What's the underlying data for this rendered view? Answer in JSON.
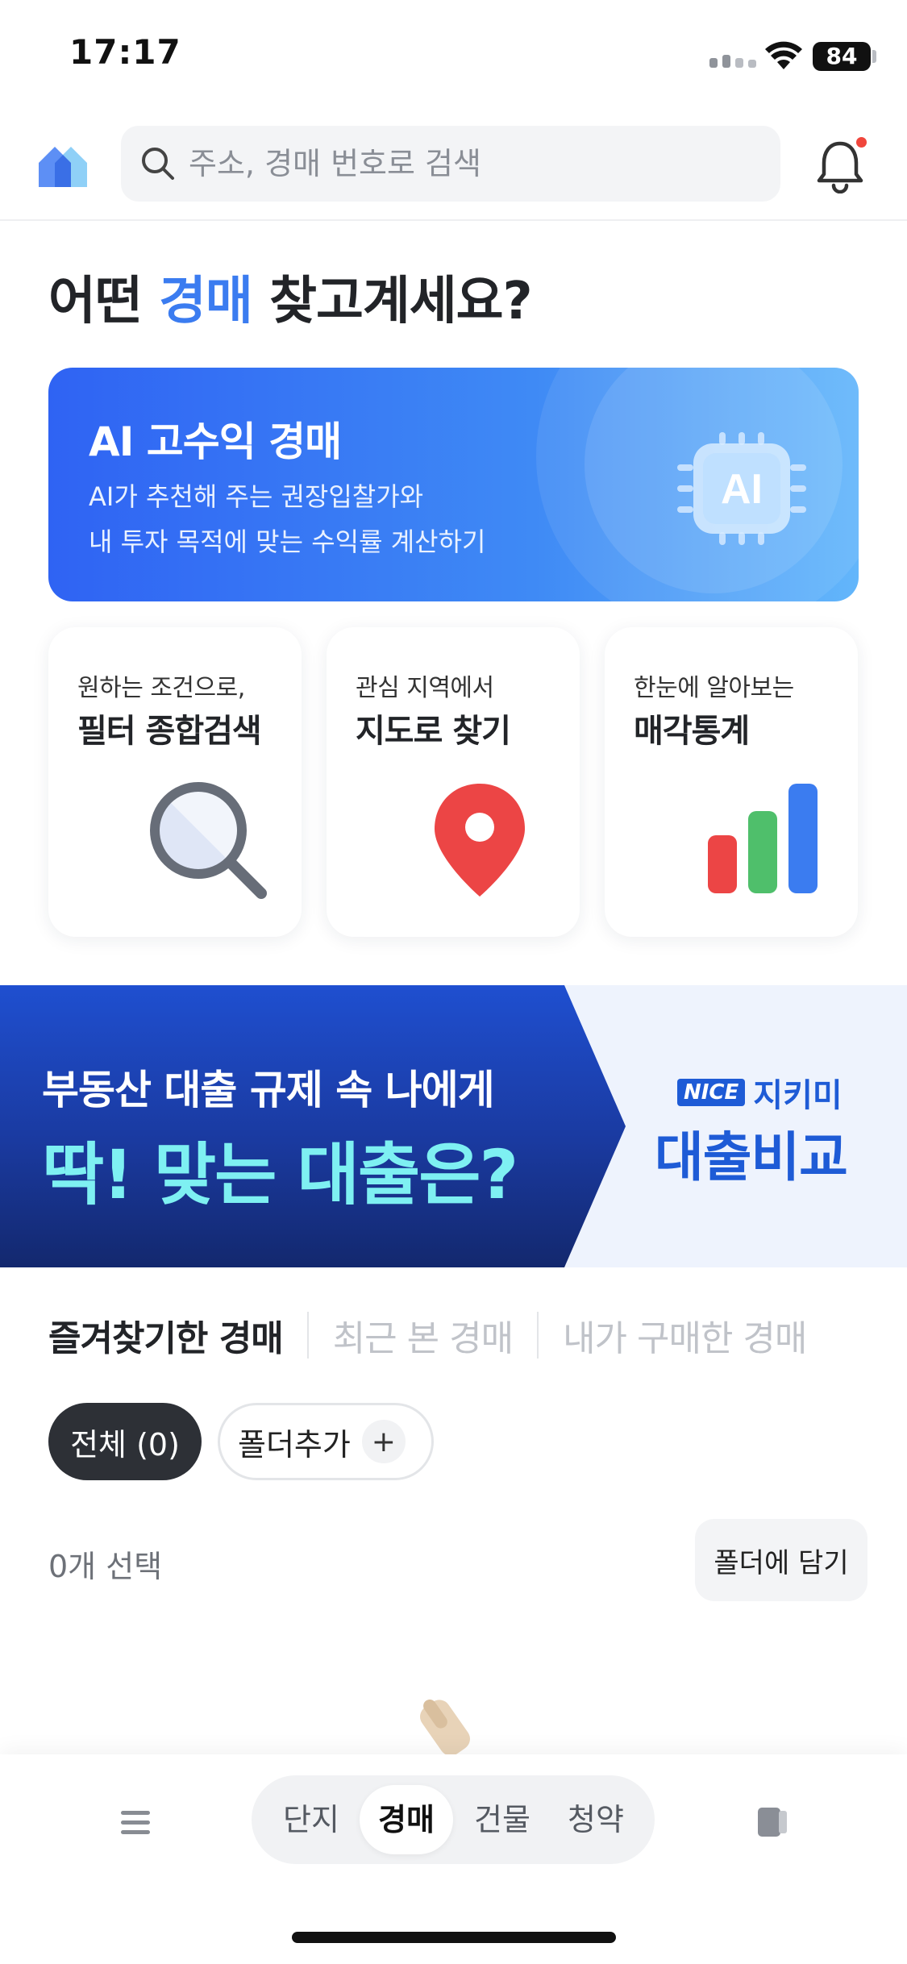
{
  "status_bar": {
    "time": "17:17",
    "battery": "84"
  },
  "header": {
    "search_placeholder": "주소, 경매 번호로 검색"
  },
  "title": {
    "prefix": "어떤 ",
    "highlight": "경매",
    "suffix": " 찾고계세요?"
  },
  "ai_banner": {
    "title": "AI 고수익 경매",
    "desc_line1": "AI가 추천해 주는 권장입찰가와",
    "desc_line2": "내 투자 목적에 맞는 수익률 계산하기",
    "chip_label": "AI"
  },
  "cards": [
    {
      "sub": "원하는 조건으로,",
      "title": "필터 종합검색"
    },
    {
      "sub": "관심 지역에서",
      "title": "지도로 찾기"
    },
    {
      "sub": "한눈에 알아보는",
      "title": "매각통계"
    }
  ],
  "loan_banner": {
    "line1": "부동산 대출 규제 속 나에게",
    "line2": "딱! 맞는 대출은?",
    "brand_badge": "NICE",
    "brand_name": "지키미",
    "compare": "대출비교"
  },
  "tabs": [
    {
      "label": "즐겨찾기한 경매"
    },
    {
      "label": "최근 본 경매"
    },
    {
      "label": "내가 구매한 경매"
    }
  ],
  "folders": {
    "all_label": "전체 (0)",
    "add_label": "폴더추가",
    "add_symbol": "+"
  },
  "selection": {
    "count_label": "0개 선택",
    "folder_button": "폴더에 담기"
  },
  "bottom_nav": {
    "segments": [
      "단지",
      "경매",
      "건물",
      "청약"
    ],
    "active_index": 1
  },
  "colors": {
    "accent": "#3b7cf0",
    "banner_blue": "#2f63f3",
    "loan_cyan": "#7ef0f2",
    "brand_blue": "#1e5bd6",
    "pin_red": "#ec4545",
    "bar_red": "#ec4545",
    "bar_green": "#4fbf6b",
    "bar_blue": "#3b7cf0"
  }
}
